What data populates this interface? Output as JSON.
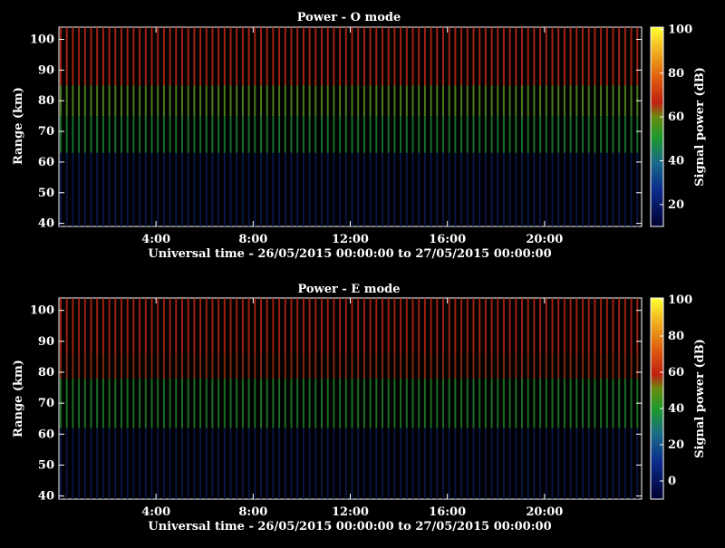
{
  "chart_data": [
    {
      "type": "heatmap",
      "title": "Power - O mode",
      "xlabel": "Universal time - 26/05/2015 00:00:00 to 27/05/2015 00:00:00",
      "ylabel": "Range (km)",
      "colorbar_label": "Signal power (dB)",
      "xlim": [
        "00:00",
        "24:00"
      ],
      "x_ticks": [
        "4:00",
        "8:00",
        "12:00",
        "16:00",
        "20:00"
      ],
      "ylim": [
        39,
        104
      ],
      "y_ticks": [
        40,
        50,
        60,
        70,
        80,
        90,
        100
      ],
      "colorbar_ticks": [
        20,
        40,
        60,
        80,
        100
      ],
      "clim": [
        10,
        101
      ],
      "bands": [
        {
          "from_km": 85,
          "to_km": 104,
          "level_db": 60,
          "color": "#cc2a16"
        },
        {
          "from_km": 75,
          "to_km": 85,
          "level_db": 50,
          "color": "#5e9a20"
        },
        {
          "from_km": 63,
          "to_km": 75,
          "level_db": 40,
          "color": "#1c8a3a"
        },
        {
          "from_km": 39,
          "to_km": 63,
          "level_db": 20,
          "color": "#0a1a5a"
        }
      ]
    },
    {
      "type": "heatmap",
      "title": "Power - E mode",
      "xlabel": "Universal time - 26/05/2015 00:00:00 to 27/05/2015 00:00:00",
      "ylabel": "Range (km)",
      "colorbar_label": "Signal power (dB)",
      "xlim": [
        "00:00",
        "24:00"
      ],
      "x_ticks": [
        "4:00",
        "8:00",
        "12:00",
        "16:00",
        "20:00"
      ],
      "ylim": [
        39,
        104
      ],
      "y_ticks": [
        40,
        50,
        60,
        70,
        80,
        90,
        100
      ],
      "colorbar_ticks": [
        0,
        20,
        40,
        60,
        80,
        100
      ],
      "clim": [
        -10,
        101
      ],
      "bands": [
        {
          "from_km": 86,
          "to_km": 104,
          "level_db": 60,
          "color": "#c42814"
        },
        {
          "from_km": 78,
          "to_km": 86,
          "level_db": 55,
          "color": "#a03010"
        },
        {
          "from_km": 62,
          "to_km": 78,
          "level_db": 40,
          "color": "#208a30"
        },
        {
          "from_km": 39,
          "to_km": 62,
          "level_db": 10,
          "color": "#0a1a55"
        }
      ]
    }
  ]
}
